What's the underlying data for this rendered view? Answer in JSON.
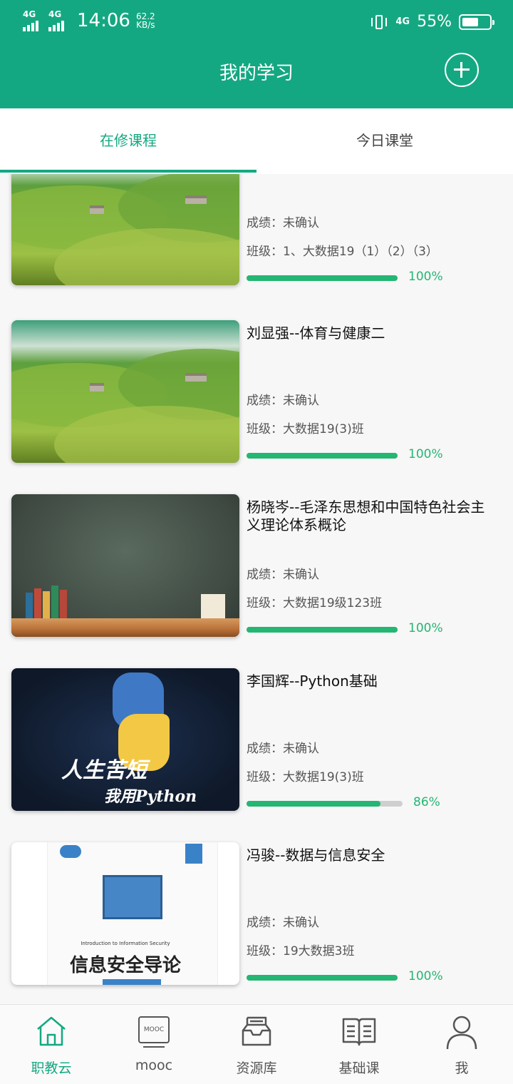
{
  "status_bar": {
    "network_1": "4G",
    "network_2": "4G",
    "time": "14:06",
    "speed_value": "62.2",
    "speed_unit": "KB/s",
    "network_right": "4G",
    "battery": "55%",
    "battery_level": 0.55
  },
  "header": {
    "title": "我的学习"
  },
  "tabs": [
    {
      "label": "在修课程",
      "active": true
    },
    {
      "label": "今日课堂",
      "active": false
    }
  ],
  "courses": [
    {
      "title": "",
      "grade": "成绩：未确认",
      "class": "班级：1、大数据19（1）（2）（3）",
      "progress": 1.0,
      "percent": "100%",
      "thumbnail": "meadow"
    },
    {
      "title": "刘显强--体育与健康二",
      "grade": "成绩：未确认",
      "class": "班级：大数据19(3)班",
      "progress": 1.0,
      "percent": "100%",
      "thumbnail": "meadow"
    },
    {
      "title": "杨晓岑--毛泽东思想和中国特色社会主义理论体系概论",
      "grade": "成绩：未确认",
      "class": "班级：大数据19级123班",
      "progress": 1.0,
      "percent": "100%",
      "thumbnail": "chalkboard"
    },
    {
      "title": "李国辉--Python基础",
      "grade": "成绩：未确认",
      "class": "班级：大数据19(3)班",
      "progress": 0.86,
      "percent": "86%",
      "thumbnail": "python",
      "thumb_text_1": "人生苦短",
      "thumb_text_2": "我用Python"
    },
    {
      "title": "冯骏--数据与信息安全",
      "grade": "成绩：未确认",
      "class": "班级：19大数据3班",
      "progress": 1.0,
      "percent": "100%",
      "thumbnail": "security-book",
      "thumb_text_en": "Introduction to Information Security",
      "thumb_text_zh": "信息安全导论"
    }
  ],
  "bottom_nav": [
    {
      "label": "职教云",
      "icon": "home-icon",
      "active": true
    },
    {
      "label": "mooc",
      "icon": "mooc-icon",
      "icon_text": "MOOC",
      "active": false
    },
    {
      "label": "资源库",
      "icon": "inbox-icon",
      "active": false
    },
    {
      "label": "基础课",
      "icon": "book-icon",
      "active": false
    },
    {
      "label": "我",
      "icon": "user-icon",
      "active": false
    }
  ],
  "colors": {
    "primary": "#14a882",
    "progress": "#24b673",
    "progress_track": "#cfcfcf"
  }
}
